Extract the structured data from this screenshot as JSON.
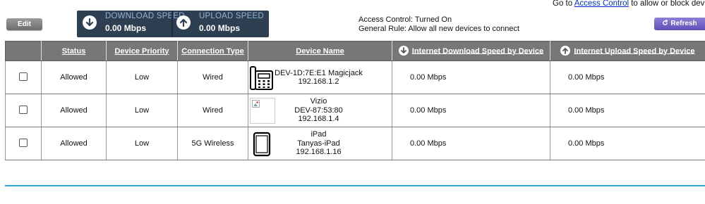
{
  "header": {
    "note_prefix": "Go to ",
    "note_link": "Access Control",
    "note_suffix": " to allow or block devices"
  },
  "toolbar": {
    "edit_label": "Edit",
    "refresh_label": "Refresh"
  },
  "speeds": {
    "download_label": "DOWNLOAD SPEED",
    "download_value": "0.00 Mbps",
    "upload_label": "UPLOAD SPEED",
    "upload_value": "0.00 Mbps"
  },
  "access": {
    "control": "Access Control: Turned On",
    "rule": "General Rule: Allow all new devices to connect"
  },
  "table": {
    "columns": [
      "",
      "Status",
      "Device Priority",
      "Connection Type",
      "Device Name",
      "Internet Download Speed by Device",
      "Internet Upload Speed by Device"
    ],
    "rows": [
      {
        "status": "Allowed",
        "priority": "Low",
        "connection": "Wired",
        "icon": "phone-icon",
        "name_lines": [
          "DEV-1D:7E:E1 Magicjack",
          "192.168.1.2"
        ],
        "download": "0.00 Mbps",
        "upload": "0.00 Mbps"
      },
      {
        "status": "Allowed",
        "priority": "Low",
        "connection": "Wired",
        "icon": "broken-image-icon",
        "name_lines": [
          "Vizio",
          "DEV-87:53:80",
          "192.168.1.4"
        ],
        "download": "0.00 Mbps",
        "upload": "0.00 Mbps"
      },
      {
        "status": "Allowed",
        "priority": "Low",
        "connection": "5G Wireless",
        "icon": "tablet-icon",
        "name_lines": [
          "iPad",
          "Tanyas-iPad",
          "192.168.1.16"
        ],
        "download": "0.00 Mbps",
        "upload": "0.00 Mbps"
      }
    ]
  }
}
